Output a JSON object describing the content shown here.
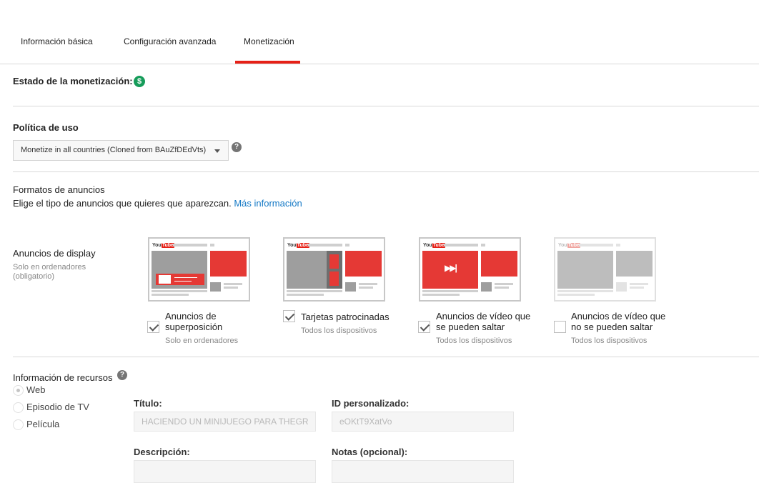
{
  "tabs": [
    {
      "label": "Información básica",
      "active": false
    },
    {
      "label": "Configuración avanzada",
      "active": false
    },
    {
      "label": "Monetización",
      "active": true
    }
  ],
  "accent_color": "#e62117",
  "link_color": "#167ac6",
  "monetization": {
    "status_label": "Estado de la monetización:",
    "status_icon": "dollar-circle-icon",
    "status_icon_glyph": "$",
    "status_color": "#169c5a"
  },
  "usage_policy": {
    "heading": "Política de uso",
    "selected": "Monetize in all countries (Cloned from BAuZfDEdVts)",
    "help_glyph": "?"
  },
  "ad_formats": {
    "heading": "Formatos de anuncios",
    "description": "Elige el tipo de anuncios que quieres que aparezcan.",
    "more_info_link": "Más información",
    "display_label": "Anuncios de display",
    "display_note_line1": "Solo en ordenadores",
    "display_note_line2": "(obligatorio)",
    "logo_you": "You",
    "logo_tube": "Tube",
    "items": [
      {
        "label_line1": "Anuncios de",
        "label_line2": "superposición",
        "note": "Solo en ordenadores",
        "checked": true
      },
      {
        "label_line1": "Tarjetas patrocinadas",
        "label_line2": "",
        "note": "Todos los dispositivos",
        "checked": true
      },
      {
        "label_line1": "Anuncios de vídeo que",
        "label_line2": "se pueden saltar",
        "note": "Todos los dispositivos",
        "checked": true
      },
      {
        "label_line1": "Anuncios de vídeo que",
        "label_line2": "no se pueden saltar",
        "note": "Todos los dispositivos",
        "checked": false
      }
    ]
  },
  "asset_info": {
    "heading": "Información de recursos",
    "types": [
      {
        "label": "Web",
        "selected": true
      },
      {
        "label": "Episodio de TV",
        "selected": false
      },
      {
        "label": "Película",
        "selected": false
      }
    ],
    "title_label": "Título:",
    "title_value": "HACIENDO UN MINIJUEGO PARA THEGR",
    "custom_id_label": "ID personalizado:",
    "custom_id_value": "eOKtT9XatVo",
    "description_label": "Descripción:",
    "description_value": "",
    "notes_label": "Notas (opcional):",
    "notes_value": ""
  }
}
